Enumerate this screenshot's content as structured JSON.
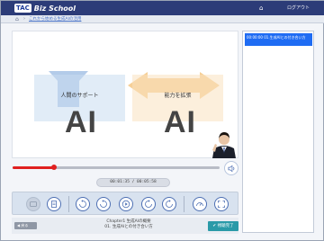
{
  "header": {
    "logo_badge": "TAC",
    "logo_text": "Biz School",
    "user_icon": "house-icon",
    "logout_label": "ログアウト"
  },
  "breadcrumb": {
    "home_icon": "home-icon",
    "separator": "›",
    "link_text": "これから始める生成AIの活用"
  },
  "slide": {
    "panel_left_label": "人間のサポート",
    "panel_right_label": "能力を拡張",
    "left_ai": "AI",
    "right_ai": "AI",
    "colors": {
      "left_panel": "#c9dcf1",
      "right_panel": "#fae1bf"
    }
  },
  "player": {
    "progress": 0.2,
    "time_display": "00:01:35 / 00:05:58",
    "accent_color": "#e02020"
  },
  "controls": {
    "icons": [
      "subtitles-icon",
      "bookmark-icon",
      "rewind-10-icon",
      "back-5-icon",
      "play-icon",
      "forward-5-icon",
      "forward-10-icon",
      "speed-icon",
      "fullscreen-icon"
    ]
  },
  "footer": {
    "prev_label": "◀ 戻る",
    "chapter_line1": "Chapter1 生成AIの概要",
    "chapter_line2": "01. 生成AIとの付き合い方",
    "complete_label": "✔ 視聴完了"
  },
  "sidebar": {
    "items": [
      {
        "label": "00:00:00 01.生成AIとの付き合い方"
      }
    ]
  }
}
